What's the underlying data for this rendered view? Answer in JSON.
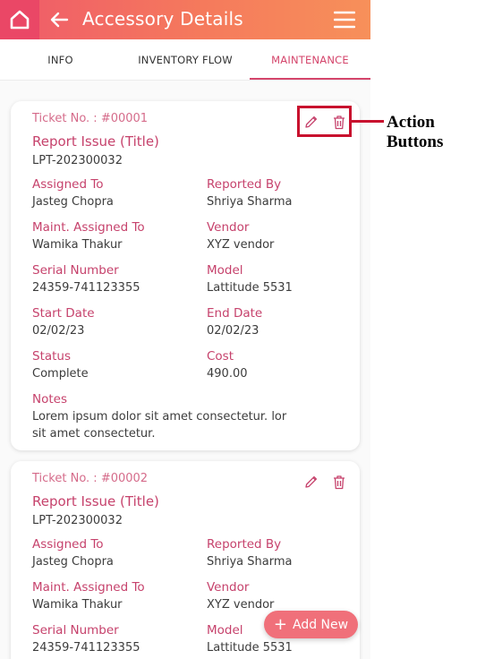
{
  "header": {
    "title": "Accessory Details"
  },
  "tabs": [
    {
      "label": "INFO"
    },
    {
      "label": "INVENTORY FLOW"
    },
    {
      "label": "MAINTENANCE",
      "active": true
    }
  ],
  "cards": [
    {
      "ticket": "Ticket No. : #00001",
      "title": "Report Issue (Title)",
      "asset": "LPT-202300032",
      "assigned_to": {
        "label": "Assigned To",
        "value": "Jasteg Chopra"
      },
      "reported_by": {
        "label": "Reported By",
        "value": "Shriya Sharma"
      },
      "maint_assigned_to": {
        "label": "Maint. Assigned To",
        "value": "Wamika Thakur"
      },
      "vendor": {
        "label": "Vendor",
        "value": "XYZ vendor"
      },
      "serial_number": {
        "label": "Serial Number",
        "value": "24359-741123355"
      },
      "model": {
        "label": "Model",
        "value": "Lattitude 5531"
      },
      "start_date": {
        "label": "Start Date",
        "value": "02/02/23"
      },
      "end_date": {
        "label": "End Date",
        "value": "02/02/23"
      },
      "status": {
        "label": "Status",
        "value": "Complete"
      },
      "cost": {
        "label": "Cost",
        "value": "490.00"
      },
      "notes": {
        "label": "Notes",
        "value": "Lorem ipsum dolor sit amet consectetur. lor sit amet consectetur."
      }
    },
    {
      "ticket": "Ticket No. : #00002",
      "title": "Report Issue (Title)",
      "asset": "LPT-202300032",
      "assigned_to": {
        "label": "Assigned To",
        "value": "Jasteg Chopra"
      },
      "reported_by": {
        "label": "Reported By",
        "value": "Shriya Sharma"
      },
      "maint_assigned_to": {
        "label": "Maint. Assigned To",
        "value": "Wamika Thakur"
      },
      "vendor": {
        "label": "Vendor",
        "value": "XYZ vendor"
      },
      "serial_number": {
        "label": "Serial Number",
        "value": "24359-741123355"
      },
      "model": {
        "label": "Model",
        "value": "Lattitude 5531"
      }
    }
  ],
  "fab": {
    "label": "Add New"
  },
  "annotation": {
    "line1": "Action",
    "line2": "Buttons"
  },
  "colors": {
    "accent": "#c6426c",
    "header_start": "#ef5a6a",
    "header_end": "#f7905a",
    "annotation": "#c8102e"
  },
  "icons": [
    "home-icon",
    "back-arrow-icon",
    "menu-icon",
    "edit-pencil-icon",
    "delete-trash-icon",
    "plus-icon"
  ]
}
